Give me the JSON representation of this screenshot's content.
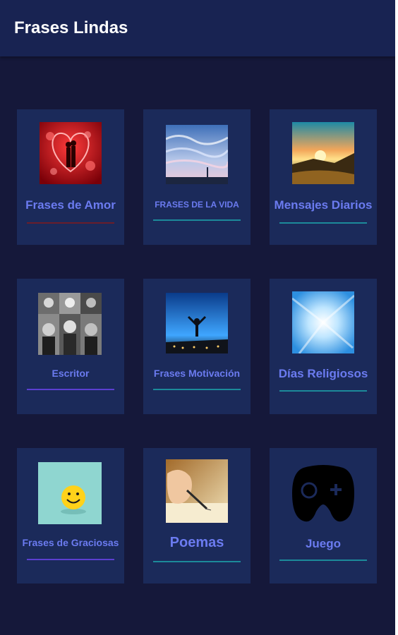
{
  "app": {
    "title": "Frases Lindas"
  },
  "categories": [
    {
      "label": "Frases de Amor",
      "icon": "hearts-couple-image",
      "underline": "#6a1d2b"
    },
    {
      "label": "FRASES DE LA VIDA",
      "icon": "sky-painting-image",
      "underline": "#1c8a9a"
    },
    {
      "label": "Mensajes Diarios",
      "icon": "sunset-image",
      "underline": "#1c8a9a"
    },
    {
      "label": "Escritor",
      "icon": "writers-portraits-image",
      "underline": "#5b3fd0"
    },
    {
      "label": "Frases Motivación",
      "icon": "motivation-silhouette-image",
      "underline": "#1c8a9a"
    },
    {
      "label": "Días Religiosos",
      "icon": "light-rays-image",
      "underline": "#1c8a9a"
    },
    {
      "label": "Frases de Graciosas",
      "icon": "smiley-image",
      "underline": "#5b3fd0"
    },
    {
      "label": "Poemas",
      "icon": "writing-hand-image",
      "underline": "#1c8a9a"
    },
    {
      "label": "Juego",
      "icon": "gamepad-icon",
      "underline": "#1c8a9a"
    }
  ]
}
